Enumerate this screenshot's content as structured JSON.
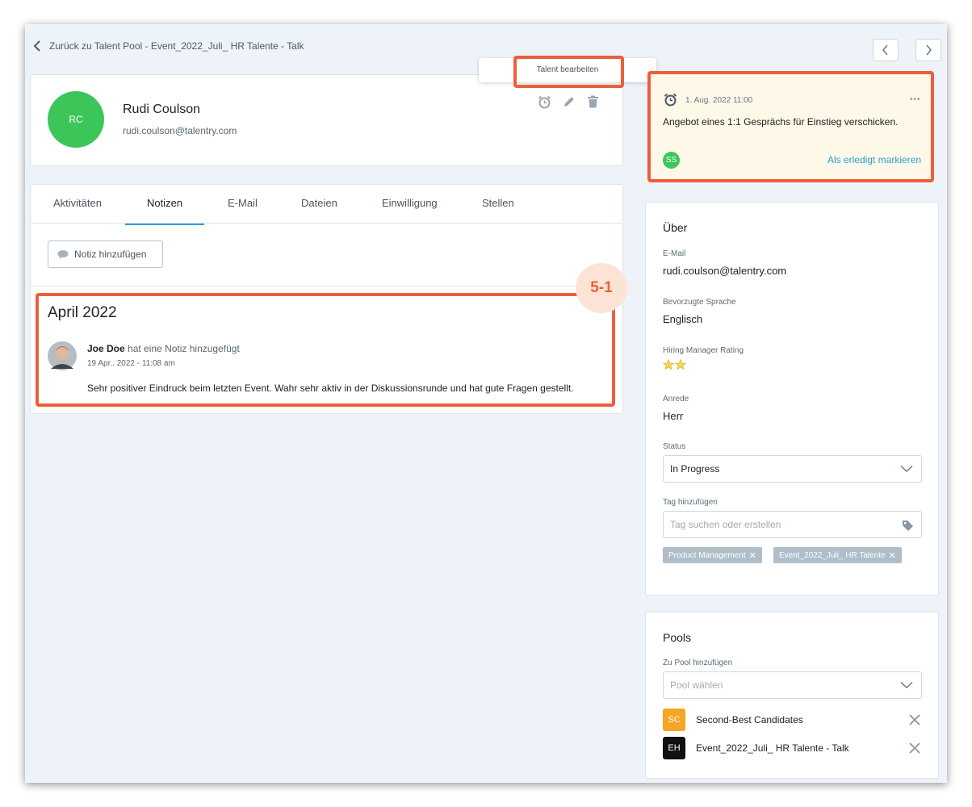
{
  "header": {
    "back_label": "Zurück zu Talent Pool - Event_2022_Juli_ HR Talente - Talk"
  },
  "tooltip": {
    "label": "Talent bearbeiten"
  },
  "profile": {
    "initials": "RC",
    "name": "Rudi Coulson",
    "email": "rudi.coulson@talentry.com",
    "avatar_color": "#3cc65a"
  },
  "tabs": [
    {
      "label": "Aktivitäten"
    },
    {
      "label": "Notizen"
    },
    {
      "label": "E-Mail"
    },
    {
      "label": "Dateien"
    },
    {
      "label": "Einwilligung"
    },
    {
      "label": "Stellen"
    }
  ],
  "active_tab": "Notizen",
  "notes": {
    "add_button": "Notiz hinzufügen",
    "month": "April 2022",
    "author": "Joe Doe",
    "action": "hat eine Notiz hinzugefügt",
    "date": "19 Apr.. 2022 - 11:08 am",
    "text": "Sehr positiver Eindruck beim letzten Event. Wahr sehr aktiv in der Diskussionsrunde und hat gute Fragen gestellt."
  },
  "badge": {
    "label": "5-1"
  },
  "reminder": {
    "date": "1. Aug. 2022 11:00",
    "text": "Angebot eines 1:1 Gesprächs für Einstieg verschicken.",
    "assignee": "SS",
    "done_label": "Als erledigt markieren",
    "more": "•••"
  },
  "about": {
    "title": "Über",
    "email_label": "E-Mail",
    "email": "rudi.coulson@talentry.com",
    "lang_label": "Bevorzugte Sprache",
    "lang": "Englisch",
    "rating_label": "Hiring Manager Rating",
    "rating": 2,
    "rating_max": 5,
    "salutation_label": "Anrede",
    "salutation": "Herr",
    "status_label": "Status",
    "status": "In Progress",
    "tag_label": "Tag hinzufügen",
    "tag_placeholder": "Tag suchen oder erstellen",
    "tags": [
      "Product Management",
      "Event_2022_Juli_ HR Talente"
    ]
  },
  "pools": {
    "title": "Pools",
    "add_label": "Zu Pool hinzufügen",
    "placeholder": "Pool wählen",
    "items": [
      {
        "initials": "SC",
        "name": "Second-Best Candidates",
        "color": "#f6a623"
      },
      {
        "initials": "EH",
        "name": "Event_2022_Juli_ HR Talente - Talk",
        "color": "#111111"
      }
    ]
  },
  "colors": {
    "accent": "#2a9fd8",
    "highlight": "#ec5f3a",
    "reminder_bg": "#fef8e8"
  }
}
